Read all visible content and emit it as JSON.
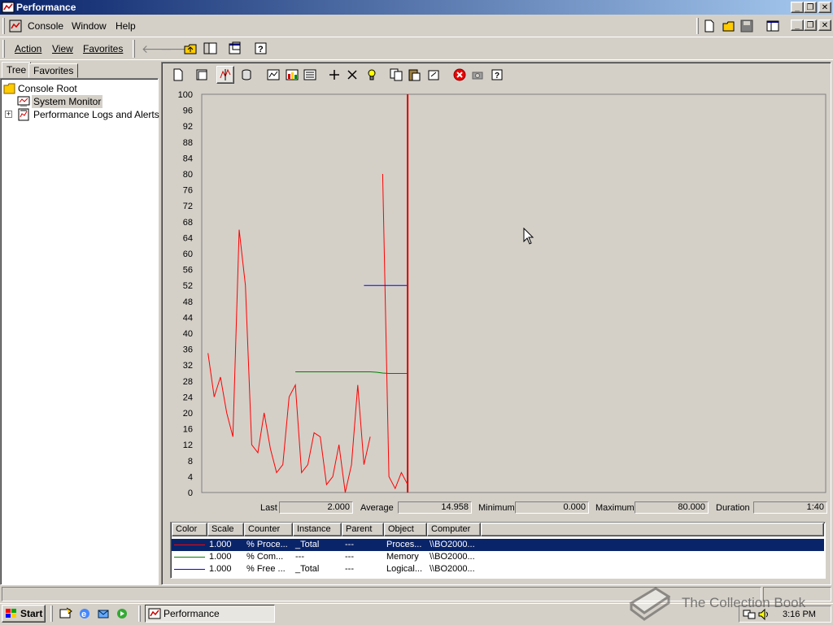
{
  "window": {
    "title": "Performance"
  },
  "menu": {
    "console": "Console",
    "window": "Window",
    "help": "Help"
  },
  "action_menu": {
    "action": "Action",
    "view": "View",
    "favorites": "Favorites"
  },
  "tabs": {
    "tree": "Tree",
    "favorites": "Favorites"
  },
  "tree": {
    "root": "Console Root",
    "system_monitor": "System Monitor",
    "perf_logs": "Performance Logs and Alerts"
  },
  "chart_data": {
    "type": "line",
    "ylim": [
      0,
      100
    ],
    "yticks": [
      0,
      4,
      8,
      12,
      16,
      20,
      24,
      28,
      32,
      36,
      40,
      44,
      48,
      52,
      56,
      60,
      64,
      68,
      72,
      76,
      80,
      84,
      88,
      92,
      96,
      100
    ],
    "x_sample_count": 100,
    "cursor_x": 33,
    "series": [
      {
        "color": "#ff0000",
        "x": [
          1,
          2,
          3,
          4,
          5,
          6,
          7,
          8,
          9,
          10,
          11,
          12,
          13,
          14,
          15,
          16,
          17,
          18,
          19,
          20,
          21,
          22,
          23,
          24,
          25,
          26,
          27,
          28,
          29,
          30,
          31,
          32,
          33
        ],
        "values": [
          35,
          24,
          29,
          20,
          14,
          66,
          52,
          12,
          10,
          20,
          11,
          5,
          7,
          24,
          27,
          5,
          7,
          15,
          14,
          2,
          4,
          12,
          0,
          7,
          27,
          7,
          14,
          null,
          80,
          4,
          1,
          5,
          2
        ]
      },
      {
        "color": "#008000",
        "x": [
          15,
          16,
          17,
          18,
          19,
          20,
          21,
          22,
          23,
          24,
          25,
          26,
          27,
          28,
          29,
          30,
          31,
          32,
          33
        ],
        "values": [
          30.3,
          30.3,
          30.3,
          30.3,
          30.3,
          30.3,
          30.3,
          30.3,
          30.3,
          30.3,
          30.3,
          30.3,
          30.3,
          30.2,
          30.0,
          29.9,
          29.9,
          29.9,
          29.9
        ]
      },
      {
        "color": "#0000ff",
        "x": [
          26,
          27,
          28,
          29,
          30,
          31,
          32,
          33
        ],
        "values": [
          52,
          52,
          52,
          52,
          52,
          52,
          52,
          52
        ]
      }
    ]
  },
  "stats": {
    "last_label": "Last",
    "last": "2.000",
    "average_label": "Average",
    "average": "14.958",
    "minimum_label": "Minimum",
    "minimum": "0.000",
    "maximum_label": "Maximum",
    "maximum": "80.000",
    "duration_label": "Duration",
    "duration": "1:40"
  },
  "legend": {
    "headers": [
      "Color",
      "Scale",
      "Counter",
      "Instance",
      "Parent",
      "Object",
      "Computer"
    ],
    "rows": [
      {
        "color": "#ff0000",
        "scale": "1.000",
        "counter": "% Proce...",
        "instance": "_Total",
        "parent": "---",
        "object": "Proces...",
        "computer": "\\\\BO2000..."
      },
      {
        "color": "#008000",
        "scale": "1.000",
        "counter": "% Com...",
        "instance": "---",
        "parent": "---",
        "object": "Memory",
        "computer": "\\\\BO2000..."
      },
      {
        "color": "#0000ff",
        "scale": "1.000",
        "counter": "% Free ...",
        "instance": "_Total",
        "parent": "---",
        "object": "Logical...",
        "computer": "\\\\BO2000..."
      }
    ]
  },
  "taskbar": {
    "start": "Start",
    "task": "Performance",
    "clock": "3:16 PM"
  },
  "watermark": "The Collection Book"
}
